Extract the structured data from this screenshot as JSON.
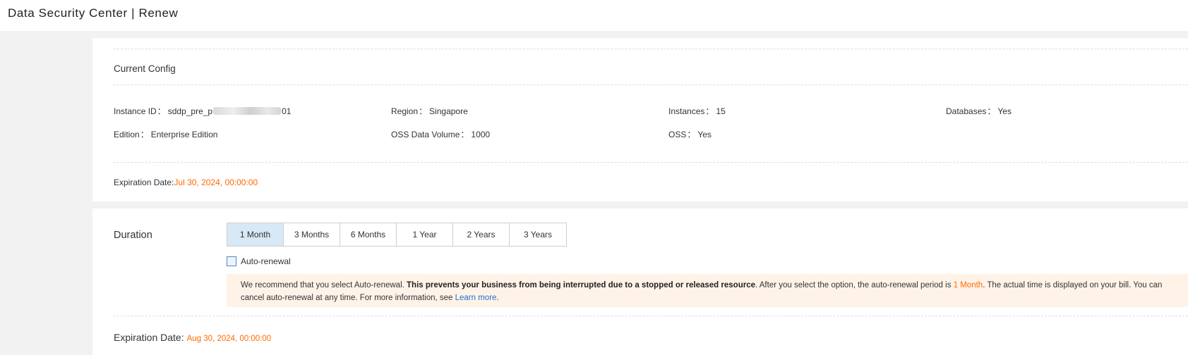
{
  "header": {
    "title": "Data Security Center | Renew"
  },
  "current_config": {
    "title": "Current Config",
    "instance_id": {
      "label": "Instance ID",
      "sep": "：",
      "prefix": "sddp_pre_p",
      "suffix": "01"
    },
    "region": {
      "label": "Region",
      "sep": "：",
      "value": "Singapore"
    },
    "instances": {
      "label": "Instances",
      "sep": "：",
      "value": "15"
    },
    "databases": {
      "label": "Databases",
      "sep": "：",
      "value": "Yes"
    },
    "edition": {
      "label": "Edition",
      "sep": "：",
      "value": "Enterprise Edition"
    },
    "oss_volume": {
      "label": "OSS Data Volume",
      "sep": "：",
      "value": "1000"
    },
    "oss": {
      "label": "OSS",
      "sep": "：",
      "value": "Yes"
    },
    "expiration": {
      "label": "Expiration Date:",
      "value": "Jul 30, 2024, 00:00:00"
    }
  },
  "duration": {
    "label": "Duration",
    "options": [
      "1 Month",
      "3 Months",
      "6 Months",
      "1 Year",
      "2 Years",
      "3 Years"
    ],
    "selected": "1 Month",
    "auto_renewal_label": "Auto-renewal",
    "auto_renewal_checked": false,
    "notice": {
      "part1": "We recommend that you select Auto-renewal. ",
      "bold": "This prevents your business from being interrupted due to a stopped or released resource",
      "part2": ". After you select the option, the auto-renewal period is ",
      "period": "1 Month",
      "part3": ". The actual time is displayed on your bill. You can cancel auto-renewal at any time. For more information, see ",
      "link": "Learn more",
      "part4": "."
    },
    "expiration": {
      "label": "Expiration Date:",
      "value": "Aug 30, 2024, 00:00:00"
    }
  },
  "colors": {
    "accent_orange": "#ff6a00",
    "selected_bg": "#d7e8f6",
    "notice_bg": "#fff3e8",
    "link_blue": "#1f6fd1"
  }
}
